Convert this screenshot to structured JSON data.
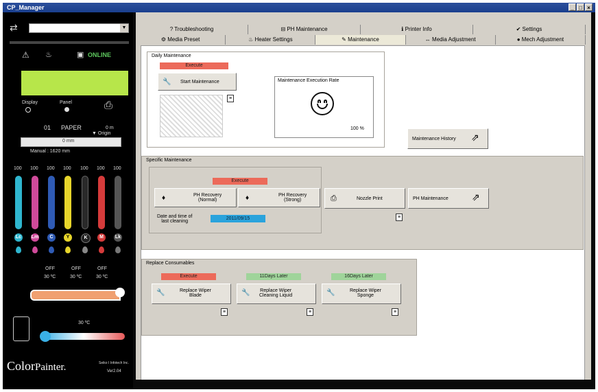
{
  "window": {
    "title": "CP_Manager",
    "controls": [
      "_",
      "□",
      "×"
    ]
  },
  "left": {
    "online": "ONLINE",
    "display_label": "Display",
    "panel_label": "Panel",
    "media": {
      "slot": "01",
      "type": "PAPER",
      "unit_m": "0 m",
      "origin": "▼ Origin",
      "width_value": "0 mm",
      "manual": "Manual : 1620 mm"
    },
    "ink": [
      {
        "pct": "100",
        "color": "#2fb6cf",
        "label": "Lc"
      },
      {
        "pct": "100",
        "color": "#d04a9a",
        "label": "Lm"
      },
      {
        "pct": "100",
        "color": "#2f5bb5",
        "label": "C"
      },
      {
        "pct": "100",
        "color": "#e7d52b",
        "label": "Y"
      },
      {
        "pct": "100",
        "color": "#2a2a2a",
        "label": "K"
      },
      {
        "pct": "100",
        "color": "#d53b3b",
        "label": "M"
      },
      {
        "pct": "100",
        "color": "#555555",
        "label": "Lk"
      }
    ],
    "heaters": [
      {
        "state": "OFF",
        "temp": "30 ºC"
      },
      {
        "state": "OFF",
        "temp": "30 ºC"
      },
      {
        "state": "OFF",
        "temp": "30 ºC"
      }
    ],
    "room_temp": "30 ºC",
    "brand": {
      "color": "Color",
      "painter": "Painter.",
      "company": "Seiko I Infotech Inc.",
      "version": "Ver2.04"
    }
  },
  "tabs": {
    "row1": [
      "Troubleshooting",
      "PH Maintenance",
      "Printer Info",
      "Settings"
    ],
    "row2": [
      "Media Preset",
      "Heater Settings",
      "Maintenance",
      "Media Adjustment",
      "Mech Adjustment"
    ],
    "active": "Maintenance"
  },
  "daily": {
    "title": "Daily Maintenance",
    "execute": "Execute",
    "start_button": "Start Maintenance",
    "rate_title": "Maintenance Execution Rate",
    "rate_value": "100 %",
    "history_button": "Maintenance History"
  },
  "specific": {
    "title": "Specific Maintenance",
    "execute": "Execute",
    "normal_button": "PH Recovery\n(Normal)",
    "strong_button": "PH Recovery\n(Strong)",
    "last_clean_label": "Date and time of\nlast cleaning",
    "last_clean_value": "2011/09/15",
    "nozzle_button": "Nozzle Print",
    "ph_button": "PH Maintenance"
  },
  "consumables": {
    "title": "Replace Consumables",
    "items": [
      {
        "status": "Execute",
        "status_color": "#ec6a5a",
        "button": "Replace Wiper\nBlade"
      },
      {
        "status": "11Days Later",
        "status_color": "#9fd49a",
        "button": "Replace Wiper\nCleaning Liquid"
      },
      {
        "status": "16Days Later",
        "status_color": "#9fd49a",
        "button": "Replace Wiper\nSponge"
      }
    ]
  }
}
